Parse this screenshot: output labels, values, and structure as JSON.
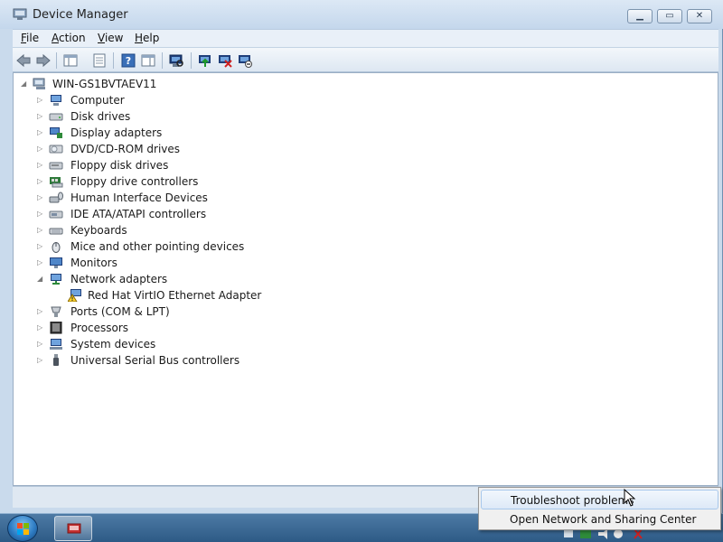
{
  "window": {
    "title": "Device Manager",
    "controls": {
      "minimize": "▁",
      "maximize": "▭",
      "close": "✕"
    }
  },
  "menubar": {
    "items": [
      {
        "label": "File"
      },
      {
        "label": "Action"
      },
      {
        "label": "View"
      },
      {
        "label": "Help"
      }
    ]
  },
  "toolbar": {
    "buttons": [
      {
        "icon": "back-arrow-icon"
      },
      {
        "icon": "forward-arrow-icon"
      },
      {
        "icon": "show-hide-console-tree-icon"
      },
      {
        "icon": "properties-icon"
      },
      {
        "icon": "help-icon"
      },
      {
        "icon": "action-pane-icon"
      },
      {
        "icon": "scan-hardware-icon"
      },
      {
        "icon": "update-driver-icon"
      },
      {
        "icon": "uninstall-device-icon"
      },
      {
        "icon": "disable-device-icon"
      }
    ]
  },
  "tree": {
    "root": {
      "label": "WIN-GS1BVTAEV11",
      "expanded": true
    },
    "categories": [
      {
        "label": "Computer",
        "icon": "computer-icon"
      },
      {
        "label": "Disk drives",
        "icon": "disk-drive-icon"
      },
      {
        "label": "Display adapters",
        "icon": "display-adapter-icon"
      },
      {
        "label": "DVD/CD-ROM drives",
        "icon": "dvd-drive-icon"
      },
      {
        "label": "Floppy disk drives",
        "icon": "floppy-drive-icon"
      },
      {
        "label": "Floppy drive controllers",
        "icon": "floppy-controller-icon"
      },
      {
        "label": "Human Interface Devices",
        "icon": "hid-icon"
      },
      {
        "label": "IDE ATA/ATAPI controllers",
        "icon": "ide-controller-icon"
      },
      {
        "label": "Keyboards",
        "icon": "keyboard-icon"
      },
      {
        "label": "Mice and other pointing devices",
        "icon": "mouse-icon"
      },
      {
        "label": "Monitors",
        "icon": "monitor-icon"
      },
      {
        "label": "Network adapters",
        "icon": "network-adapter-icon",
        "expanded": true
      },
      {
        "label": "Red Hat VirtIO Ethernet Adapter",
        "icon": "warning-network-icon",
        "child": true
      },
      {
        "label": "Ports (COM & LPT)",
        "icon": "port-icon"
      },
      {
        "label": "Processors",
        "icon": "processor-icon"
      },
      {
        "label": "System devices",
        "icon": "system-device-icon"
      },
      {
        "label": "Universal Serial Bus controllers",
        "icon": "usb-icon"
      }
    ]
  },
  "context_menu": {
    "items": [
      {
        "label": "Troubleshoot problems",
        "highlighted": true
      },
      {
        "label": "Open Network and Sharing Center"
      }
    ]
  },
  "taskbar": {
    "start_icon": "windows-flag-icon",
    "pinned_icon": "device-manager-icon",
    "tray_icons": [
      "flag-icon",
      "network-icon",
      "volume-icon",
      "speaker-icon"
    ]
  },
  "colors": {
    "title_bg": "#c4d7ec",
    "content_bg": "#ffffff",
    "taskbar_bg": "#2d5a86",
    "menu_hover": "#dde9f7"
  }
}
